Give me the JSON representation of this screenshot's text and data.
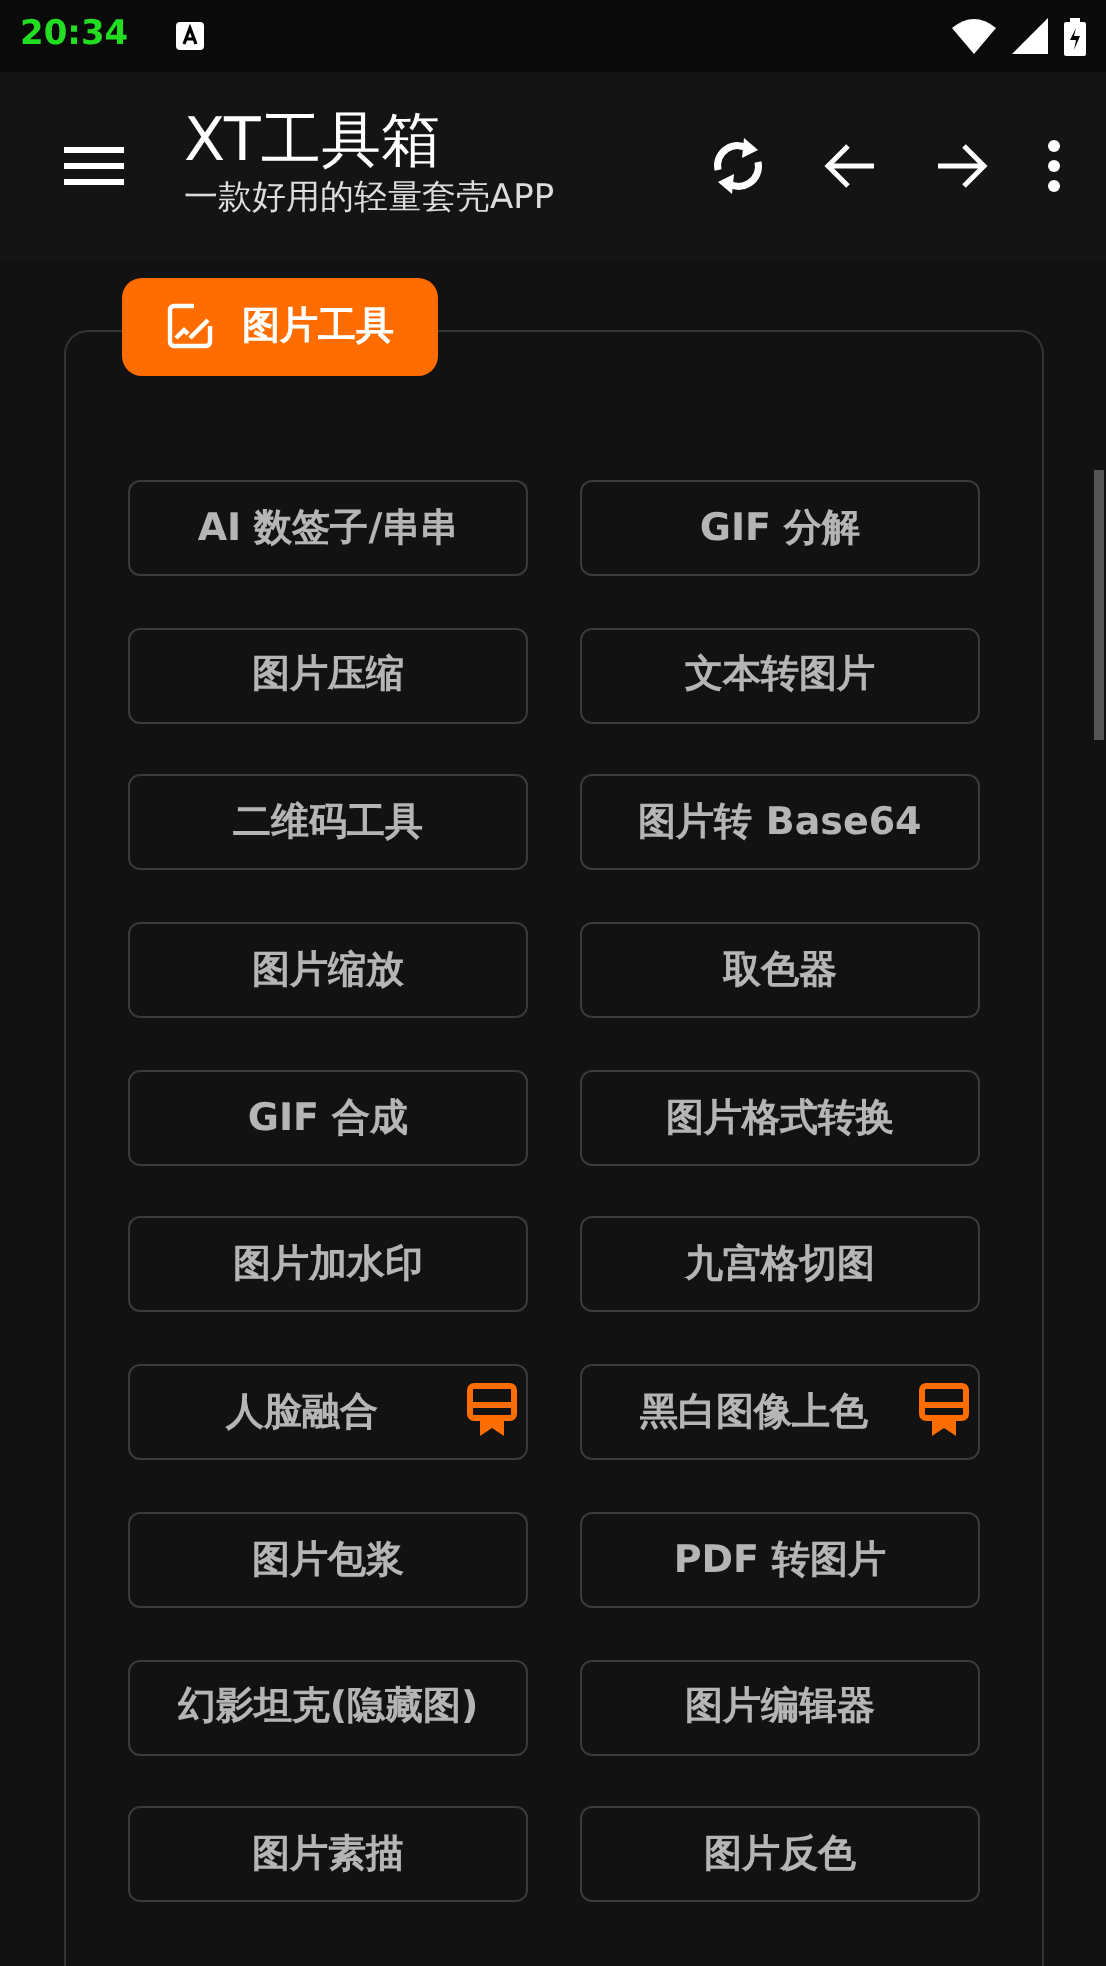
{
  "status_bar": {
    "time": "20:34"
  },
  "app_bar": {
    "title": "XT工具箱",
    "subtitle": "一款好用的轻量套壳APP"
  },
  "section": {
    "title": "图片工具",
    "tools": [
      {
        "label": "AI 数签子/串串",
        "premium": false
      },
      {
        "label": "GIF 分解",
        "premium": false
      },
      {
        "label": "图片压缩",
        "premium": false
      },
      {
        "label": "文本转图片",
        "premium": false
      },
      {
        "label": "二维码工具",
        "premium": false
      },
      {
        "label": "图片转 Base64",
        "premium": false
      },
      {
        "label": "图片缩放",
        "premium": false
      },
      {
        "label": "取色器",
        "premium": false
      },
      {
        "label": "GIF 合成",
        "premium": false
      },
      {
        "label": "图片格式转换",
        "premium": false
      },
      {
        "label": "图片加水印",
        "premium": false
      },
      {
        "label": "九宫格切图",
        "premium": false
      },
      {
        "label": "人脸融合",
        "premium": true
      },
      {
        "label": "黑白图像上色",
        "premium": true
      },
      {
        "label": "图片包浆",
        "premium": false
      },
      {
        "label": "PDF 转图片",
        "premium": false
      },
      {
        "label": "幻影坦克(隐藏图)",
        "premium": false
      },
      {
        "label": "图片编辑器",
        "premium": false
      },
      {
        "label": "图片素描",
        "premium": false
      },
      {
        "label": "图片反色",
        "premium": false
      }
    ]
  }
}
